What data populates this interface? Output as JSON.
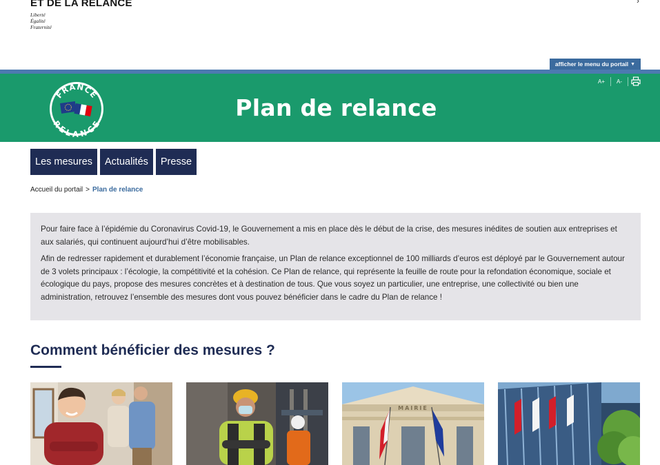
{
  "header": {
    "ministry_title": "ET DE LA RELANCE",
    "motto": [
      "Liberté",
      "Égalité",
      "Fraternité"
    ],
    "portal_menu_label": "afficher le menu du portail"
  },
  "banner": {
    "title": "Plan de relance",
    "logo_text_top": "FRANCE",
    "logo_text_bottom": "RELANCE",
    "font_increase": "A+",
    "font_decrease": "A-",
    "colors": {
      "green": "#1a9a6c",
      "stripe": "#4c7ab0"
    }
  },
  "nav": {
    "items": [
      {
        "label": "Les mesures"
      },
      {
        "label": "Actualités"
      },
      {
        "label": "Presse"
      }
    ]
  },
  "breadcrumb": {
    "home": "Accueil du portail",
    "separator": ">",
    "current": "Plan de relance"
  },
  "intro": {
    "paragraph_1": "Pour faire face à l’épidémie du Coronavirus Covid-19, le Gouvernement a mis en place dès le début de la crise, des mesures inédites de soutien aux entreprises et aux salariés, qui continuent aujourd’hui d’être mobilisables.",
    "paragraph_2": "Afin de redresser rapidement et durablement l’économie française, un Plan de relance exceptionnel de 100 milliards d’euros est déployé par le Gouvernement autour de 3 volets principaux : l’écologie, la compétitivité et la cohésion. Ce Plan de relance, qui représente la feuille de route pour la refondation économique, sociale et écologique du pays, propose des mesures concrètes et à destination de tous. Que vous soyez un particulier, une entreprise, une collectivité ou bien une administration, retrouvez l’ensemble des mesures dont vous pouvez bénéficier dans le cadre du Plan de relance !"
  },
  "section": {
    "title": "Comment bénéficier des mesures ?",
    "cards": [
      {
        "image": "particulier-photo"
      },
      {
        "image": "entreprise-photo"
      },
      {
        "image": "collectivite-photo",
        "sign": "MAIRIE"
      },
      {
        "image": "administration-photo"
      }
    ]
  }
}
